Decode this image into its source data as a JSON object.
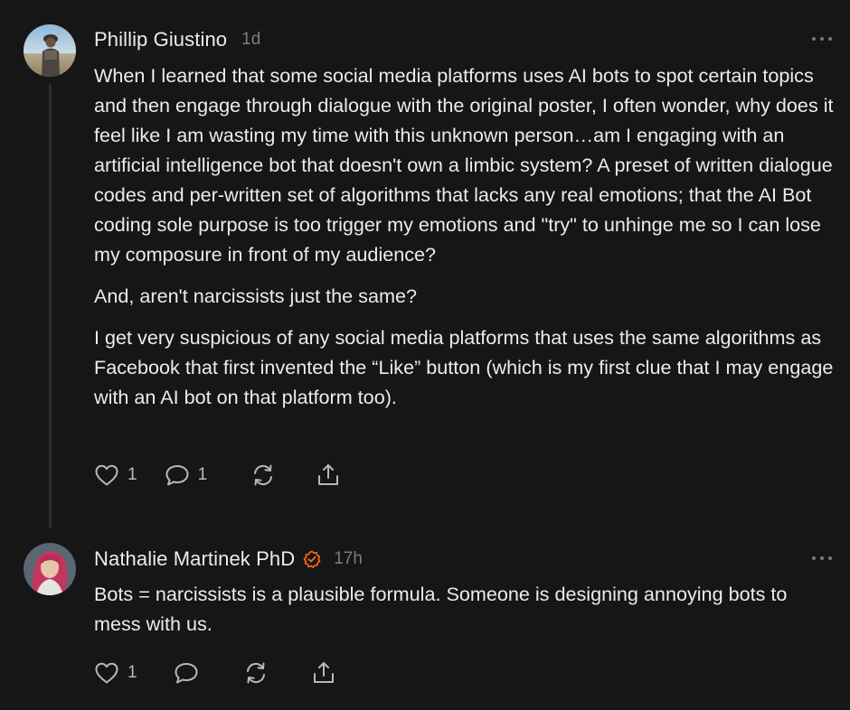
{
  "comments": [
    {
      "author": "Phillip Giustino",
      "time": "1d",
      "verified": false,
      "paragraphs": [
        "When I learned that some social media platforms uses AI bots to spot certain topics and then engage through dialogue with the original poster, I often wonder, why does it feel like I am wasting my time with this unknown person…am I engaging with an artificial intelligence bot that doesn't own a limbic system? A preset of written dialogue codes and per-written set of algorithms that lacks any real emotions; that the AI Bot coding sole purpose is too trigger my emotions and \"try\" to unhinge me so I can lose my composure in front of my audience?",
        "And, aren't narcissists just the same?",
        "I get very suspicious of any social media platforms that uses the same algorithms as Facebook that first invented the “Like” button (which is my first clue that I may engage with an AI bot on that platform too)."
      ],
      "likes": "1",
      "replies": "1",
      "icons": {
        "like": "heart-icon",
        "reply": "comment-icon",
        "restack": "restack-icon",
        "share": "share-icon",
        "more": "more-dots-icon"
      }
    },
    {
      "author": "Nathalie Martinek PhD",
      "time": "17h",
      "verified": true,
      "verified_color": "#ff6719",
      "paragraphs": [
        "Bots = narcissists is a plausible formula. Someone is designing annoying bots to mess with us."
      ],
      "likes": "1",
      "icons": {
        "like": "heart-icon",
        "reply": "comment-icon",
        "restack": "restack-icon",
        "share": "share-icon",
        "more": "more-dots-icon"
      }
    }
  ],
  "colors": {
    "background": "#161616",
    "text": "#ececec",
    "muted": "#7d7d7d",
    "accent": "#ff6719"
  }
}
